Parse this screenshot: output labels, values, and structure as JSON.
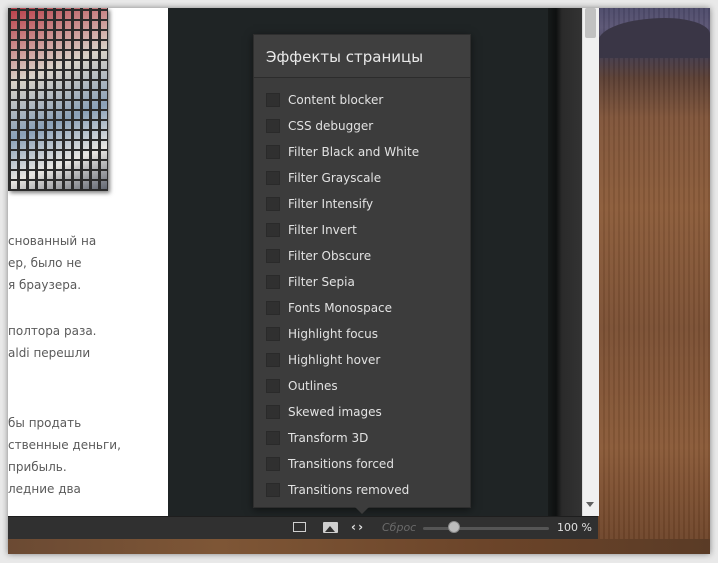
{
  "article": {
    "lines_block1": [
      "снованный на",
      "ер, было не",
      "я браузера."
    ],
    "lines_block2": [
      "полтора раза.",
      "aldi перешли"
    ],
    "lines_block3": [
      "бы продать",
      "ственные деньги,",
      "прибыль.",
      "ледние два"
    ]
  },
  "popup": {
    "title": "Эффекты страницы",
    "effects": [
      {
        "label": "Content blocker",
        "checked": false
      },
      {
        "label": "CSS debugger",
        "checked": false
      },
      {
        "label": "Filter Black and White",
        "checked": false
      },
      {
        "label": "Filter Grayscale",
        "checked": false
      },
      {
        "label": "Filter Intensify",
        "checked": false
      },
      {
        "label": "Filter Invert",
        "checked": false
      },
      {
        "label": "Filter Obscure",
        "checked": false
      },
      {
        "label": "Filter Sepia",
        "checked": false
      },
      {
        "label": "Fonts Monospace",
        "checked": false
      },
      {
        "label": "Highlight focus",
        "checked": false
      },
      {
        "label": "Highlight hover",
        "checked": false
      },
      {
        "label": "Outlines",
        "checked": false
      },
      {
        "label": "Skewed images",
        "checked": false
      },
      {
        "label": "Transform 3D",
        "checked": false
      },
      {
        "label": "Transitions forced",
        "checked": false
      },
      {
        "label": "Transitions removed",
        "checked": false
      }
    ]
  },
  "statusbar": {
    "window_icon": "window-icon",
    "image_icon": "image-icon",
    "code_icon": "code-brackets-icon",
    "code_glyph": "‹ ›",
    "reset_label": "Сброс",
    "zoom_value": "100 %",
    "zoom_level": 0.22
  },
  "colors": {
    "popup_bg": "#3c3c3c",
    "statusbar_bg": "#303030",
    "page_dark_bg": "#1f2425"
  }
}
